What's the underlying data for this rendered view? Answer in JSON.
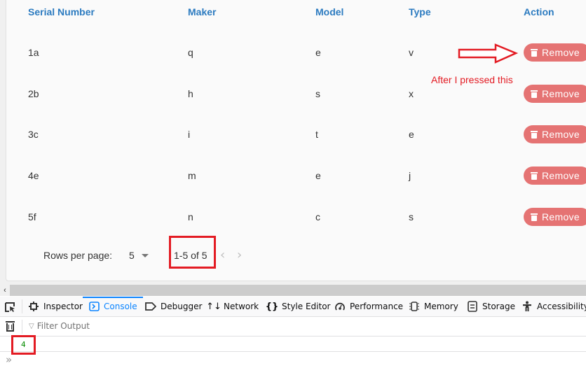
{
  "table": {
    "headers": [
      "Serial Number",
      "Maker",
      "Model",
      "Type",
      "Action"
    ],
    "rows": [
      {
        "serial": "1a",
        "maker": "q",
        "model": "e",
        "type": "v",
        "action": "Remove"
      },
      {
        "serial": "2b",
        "maker": "h",
        "model": "s",
        "type": "x",
        "action": "Remove"
      },
      {
        "serial": "3c",
        "maker": "i",
        "model": "t",
        "type": "e",
        "action": "Remove"
      },
      {
        "serial": "4e",
        "maker": "m",
        "model": "e",
        "type": "j",
        "action": "Remove"
      },
      {
        "serial": "5f",
        "maker": "n",
        "model": "c",
        "type": "s",
        "action": "Remove"
      }
    ],
    "header_color": "#2c7bc0",
    "remove_button_color": "#e57373"
  },
  "pagination": {
    "rows_per_page_label": "Rows per page:",
    "rows_per_page_value": "5",
    "range_text": "1-5 of 5",
    "prev_icon": "‹",
    "next_icon": "›"
  },
  "annotation": {
    "text": "After I pressed this",
    "color": "#e31b23"
  },
  "devtools": {
    "tabs": [
      {
        "label": "Inspector",
        "icon": "inspector-icon",
        "active": false
      },
      {
        "label": "Console",
        "icon": "console-icon",
        "active": true
      },
      {
        "label": "Debugger",
        "icon": "debugger-icon",
        "active": false
      },
      {
        "label": "Network",
        "icon": "network-icon",
        "active": false
      },
      {
        "label": "Style Editor",
        "icon": "style-editor-icon",
        "active": false
      },
      {
        "label": "Performance",
        "icon": "performance-icon",
        "active": false
      },
      {
        "label": "Memory",
        "icon": "memory-icon",
        "active": false
      },
      {
        "label": "Storage",
        "icon": "storage-icon",
        "active": false
      },
      {
        "label": "Accessibility",
        "icon": "accessibility-icon",
        "active": false
      }
    ],
    "filter_placeholder": "Filter Output",
    "console_output": [
      "4"
    ],
    "prompt_symbol": "»"
  }
}
